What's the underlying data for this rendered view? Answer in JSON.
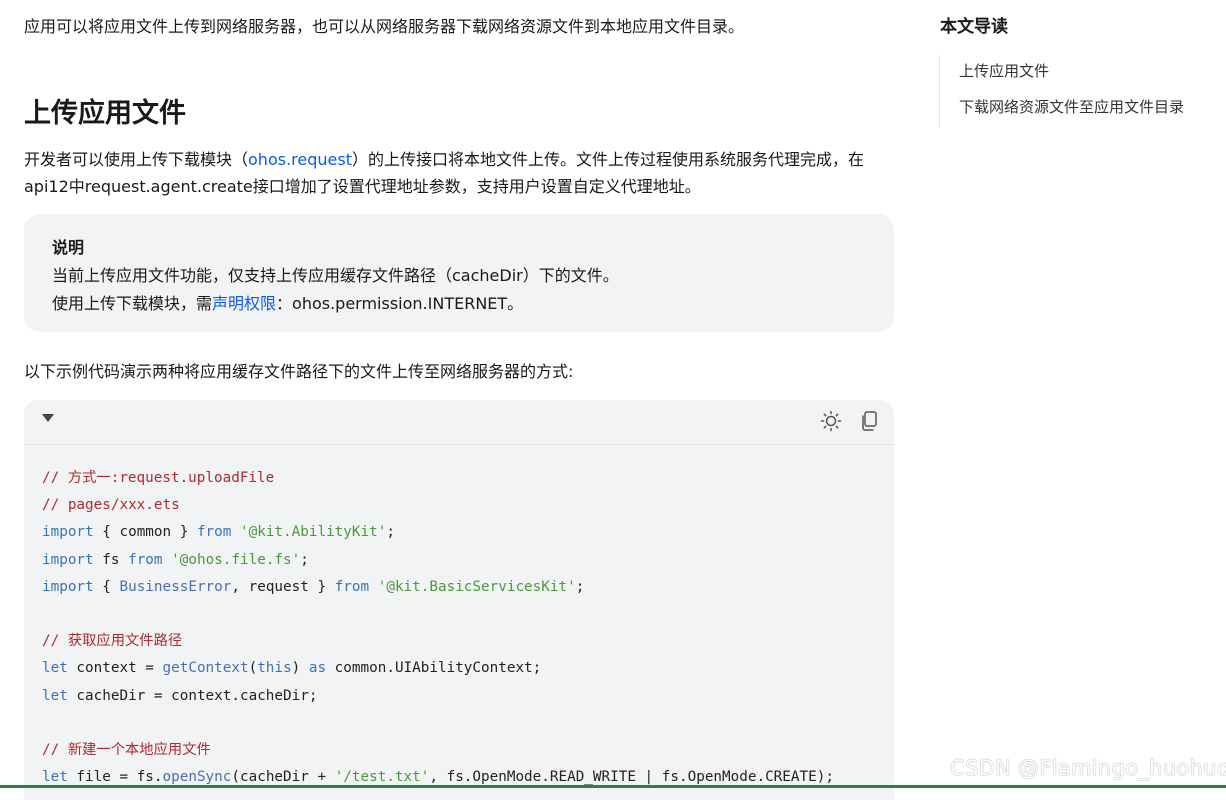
{
  "intro": "应用可以将应用文件上传到网络服务器，也可以从网络服务器下载网络资源文件到本地应用文件目录。",
  "heading": "上传应用文件",
  "para": {
    "before": "开发者可以使用上传下载模块（",
    "link": "ohos.request",
    "after": "）的上传接口将本地文件上传。文件上传过程使用系统服务代理完成，在api12中request.agent.create接口增加了设置代理地址参数，支持用户设置自定义代理地址。"
  },
  "note": {
    "title": "说明",
    "line1": "当前上传应用文件功能，仅支持上传应用缓存文件路径（cacheDir）下的文件。",
    "line2_before": "使用上传下载模块，需",
    "line2_link": "声明权限",
    "line2_after": "：ohos.permission.INTERNET。"
  },
  "lead": "以下示例代码演示两种将应用缓存文件路径下的文件上传至网络服务器的方式:",
  "code": {
    "c1": "// 方式一:request.uploadFile",
    "c2": "// pages/xxx.ets",
    "c3": "// 获取应用文件路径",
    "c4": "// 新建一个本地应用文件",
    "kw_import": "import",
    "kw_from": "from",
    "kw_let": "let",
    "kw_this": "this",
    "kw_as": "as",
    "l3_mid": " { common } ",
    "l3_str": "'@kit.AbilityKit'",
    "l4_mid": " fs ",
    "l4_str": "'@ohos.file.fs'",
    "l5_open": " { ",
    "l5_type": "BusinessError",
    "l5_rest": ", request } ",
    "l5_str": "'@kit.BasicServicesKit'",
    "semi": ";",
    "l7_a": " context = ",
    "l7_fn": "getContext",
    "l7_rest": " common.UIAbilityContext;",
    "l8": " cacheDir = context.cacheDir;",
    "l10_a": " file = fs.",
    "l10_fn": "openSync",
    "l10_b": "(cacheDir + ",
    "l10_str": "'/test.txt'",
    "l10_c": ", fs.OpenMode.READ_WRITE | fs.OpenMode.CREATE);"
  },
  "toc": {
    "title": "本文导读",
    "items": [
      "上传应用文件",
      "下载网络资源文件至应用文件目录"
    ]
  },
  "watermark": "CSDN @Flamingo_huohuo",
  "colors": {
    "link": "#0a59f7",
    "comment": "#b2292e",
    "keyword": "#3b73b9",
    "string": "#4a9a3c",
    "bottom_bar": "#2e7d4a"
  },
  "icons": {
    "collapse": "triangle-down-icon",
    "theme": "sun-icon",
    "copy": "copy-icon"
  }
}
